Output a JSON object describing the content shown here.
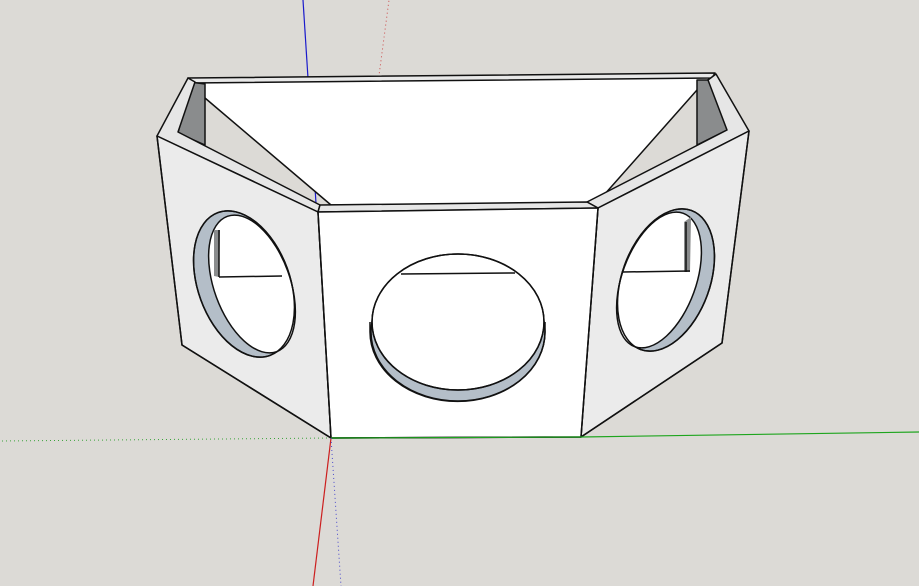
{
  "scene": {
    "background_color": "#dcdad6",
    "model_face_color": "#ffffff",
    "side_face_color": "#ebebeb",
    "rim_color": "#d0d3d6",
    "hole_wall_color": "#b4bec8",
    "inner_shadow_color": "#8a8c8d",
    "edge_color": "#111111",
    "axis_red_color": "#cc1f1f",
    "axis_green_color": "#1ea51e",
    "axis_blue_color": "#1a1acc"
  },
  "model": {
    "name": "speaker-box-enclosure",
    "icon": "3d-model-icon"
  }
}
